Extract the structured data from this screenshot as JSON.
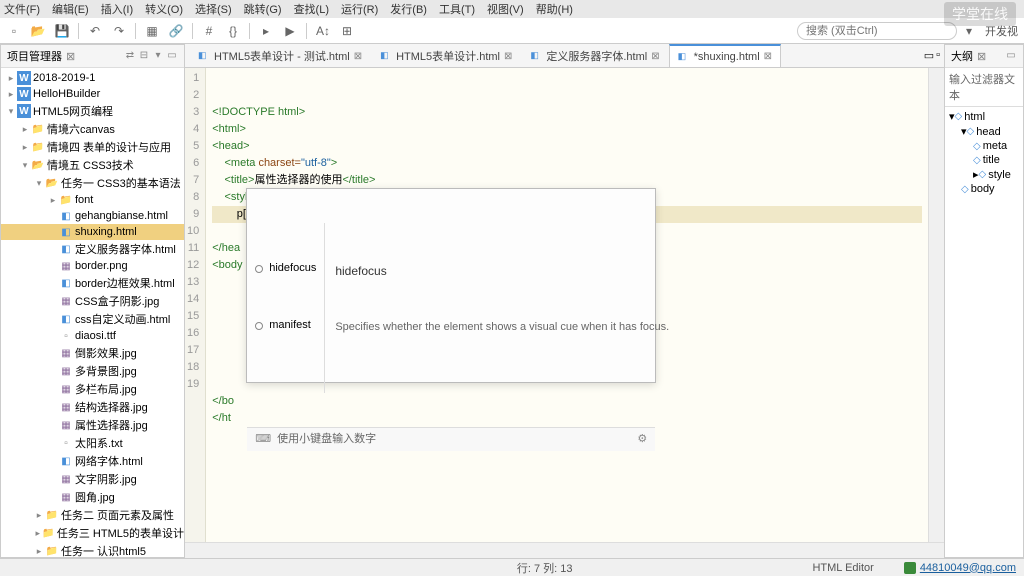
{
  "menu": {
    "items": [
      "文件(F)",
      "编辑(E)",
      "插入(I)",
      "转义(O)",
      "选择(S)",
      "跳转(G)",
      "查找(L)",
      "运行(R)",
      "发行(B)",
      "工具(T)",
      "视图(V)",
      "帮助(H)"
    ]
  },
  "watermark": "学堂在线",
  "search": {
    "placeholder": "搜索 (双击Ctrl)"
  },
  "toolbar_right": "开发视",
  "left_panel": {
    "title": "项目管理器"
  },
  "tree": [
    {
      "depth": 0,
      "tw": "▸",
      "ico": "ic-w",
      "label": "2018-2019-1"
    },
    {
      "depth": 0,
      "tw": "▸",
      "ico": "ic-w",
      "label": "HelloHBuilder"
    },
    {
      "depth": 0,
      "tw": "▾",
      "ico": "ic-w",
      "label": "HTML5网页编程"
    },
    {
      "depth": 1,
      "tw": "▸",
      "ico": "ic-folder",
      "label": "情境六canvas"
    },
    {
      "depth": 1,
      "tw": "▸",
      "ico": "ic-folder",
      "label": "情境四 表单的设计与应用"
    },
    {
      "depth": 1,
      "tw": "▾",
      "ico": "ic-folder-open",
      "label": "情境五 CSS3技术"
    },
    {
      "depth": 2,
      "tw": "▾",
      "ico": "ic-folder-open",
      "label": "任务一 CSS3的基本语法"
    },
    {
      "depth": 3,
      "tw": "▸",
      "ico": "ic-folder",
      "label": "font"
    },
    {
      "depth": 3,
      "tw": "",
      "ico": "ic-html",
      "label": "gehangbianse.html"
    },
    {
      "depth": 3,
      "tw": "",
      "ico": "ic-html",
      "label": "shuxing.html",
      "sel": true
    },
    {
      "depth": 3,
      "tw": "",
      "ico": "ic-html",
      "label": "定义服务器字体.html"
    },
    {
      "depth": 3,
      "tw": "",
      "ico": "ic-img",
      "label": "border.png"
    },
    {
      "depth": 3,
      "tw": "",
      "ico": "ic-html",
      "label": "border边框效果.html"
    },
    {
      "depth": 3,
      "tw": "",
      "ico": "ic-img",
      "label": "CSS盒子阴影.jpg"
    },
    {
      "depth": 3,
      "tw": "",
      "ico": "ic-html",
      "label": "css自定义动画.html"
    },
    {
      "depth": 3,
      "tw": "",
      "ico": "ic-file",
      "label": "diaosi.ttf"
    },
    {
      "depth": 3,
      "tw": "",
      "ico": "ic-img",
      "label": "倒影效果.jpg"
    },
    {
      "depth": 3,
      "tw": "",
      "ico": "ic-img",
      "label": "多背景图.jpg"
    },
    {
      "depth": 3,
      "tw": "",
      "ico": "ic-img",
      "label": "多栏布局.jpg"
    },
    {
      "depth": 3,
      "tw": "",
      "ico": "ic-img",
      "label": "结构选择器.jpg"
    },
    {
      "depth": 3,
      "tw": "",
      "ico": "ic-img",
      "label": "属性选择器.jpg"
    },
    {
      "depth": 3,
      "tw": "",
      "ico": "ic-file",
      "label": "太阳系.txt"
    },
    {
      "depth": 3,
      "tw": "",
      "ico": "ic-html",
      "label": "网络字体.html"
    },
    {
      "depth": 3,
      "tw": "",
      "ico": "ic-img",
      "label": "文字阴影.jpg"
    },
    {
      "depth": 3,
      "tw": "",
      "ico": "ic-img",
      "label": "圆角.jpg"
    },
    {
      "depth": 2,
      "tw": "▸",
      "ico": "ic-folder",
      "label": "任务二 页面元素及属性"
    },
    {
      "depth": 2,
      "tw": "▸",
      "ico": "ic-folder",
      "label": "任务三 HTML5的表单设计"
    },
    {
      "depth": 2,
      "tw": "▸",
      "ico": "ic-folder",
      "label": "任务一 认识html5"
    }
  ],
  "tabs": [
    {
      "label": "HTML5表单设计 - 测试.html",
      "active": false
    },
    {
      "label": "HTML5表单设计.html",
      "active": false
    },
    {
      "label": "定义服务器字体.html",
      "active": false
    },
    {
      "label": "*shuxing.html",
      "active": true
    }
  ],
  "code_lines": [
    {
      "n": 1,
      "html": "<span class='k-doc'>&lt;!DOCTYPE html&gt;</span>"
    },
    {
      "n": 2,
      "html": "<span class='k-tag'>&lt;html&gt;</span>"
    },
    {
      "n": 3,
      "html": "<span class='k-tag'>&lt;head&gt;</span>"
    },
    {
      "n": 4,
      "html": "    <span class='k-tag'>&lt;meta</span> <span class='k-attr'>charset=</span><span class='k-str'>\"utf-8\"</span><span class='k-tag'>&gt;</span>"
    },
    {
      "n": 5,
      "html": "    <span class='k-tag'>&lt;title&gt;</span>属性选择器的使用<span class='k-tag'>&lt;/title&gt;</span>"
    },
    {
      "n": 6,
      "html": "    <span class='k-tag'>&lt;style</span> <span class='k-attr'>type=</span><span class='k-str'>\"text/css\"</span><span class='k-tag'>&gt;</span>"
    },
    {
      "n": 7,
      "html": "        p[if]",
      "cur": true
    },
    {
      "n": 8,
      "html": ""
    },
    {
      "n": 9,
      "html": "<span class='k-tag'>&lt;/hea</span>"
    },
    {
      "n": 10,
      "html": "<span class='k-tag'>&lt;body</span>"
    },
    {
      "n": 11,
      "html": ""
    },
    {
      "n": 12,
      "html": ""
    },
    {
      "n": 13,
      "html": ""
    },
    {
      "n": 14,
      "html": ""
    },
    {
      "n": 15,
      "html": ""
    },
    {
      "n": 16,
      "html": ""
    },
    {
      "n": 17,
      "html": ""
    },
    {
      "n": 18,
      "html": "<span class='k-tag'>&lt;/bo</span>"
    },
    {
      "n": 19,
      "html": "<span class='k-tag'>&lt;/ht</span>"
    }
  ],
  "popup": {
    "items": [
      "hidefocus",
      "manifest"
    ],
    "doc_title": "hidefocus",
    "doc_desc": "Specifies whether the element shows a visual cue when it has focus.",
    "foot": "使用小键盘输入数字"
  },
  "outline_hdr": "大纲",
  "outline_filter": "输入过滤器文本",
  "outline": [
    {
      "depth": 0,
      "tw": "▾",
      "label": "html"
    },
    {
      "depth": 1,
      "tw": "▾",
      "label": "head"
    },
    {
      "depth": 2,
      "tw": "",
      "label": "meta"
    },
    {
      "depth": 2,
      "tw": "",
      "label": "title"
    },
    {
      "depth": 2,
      "tw": "▸",
      "label": "style"
    },
    {
      "depth": 1,
      "tw": "",
      "label": "body"
    }
  ],
  "status": {
    "pos": "行: 7 列: 13",
    "mode": "HTML Editor",
    "user": "44810049@qq.com"
  }
}
